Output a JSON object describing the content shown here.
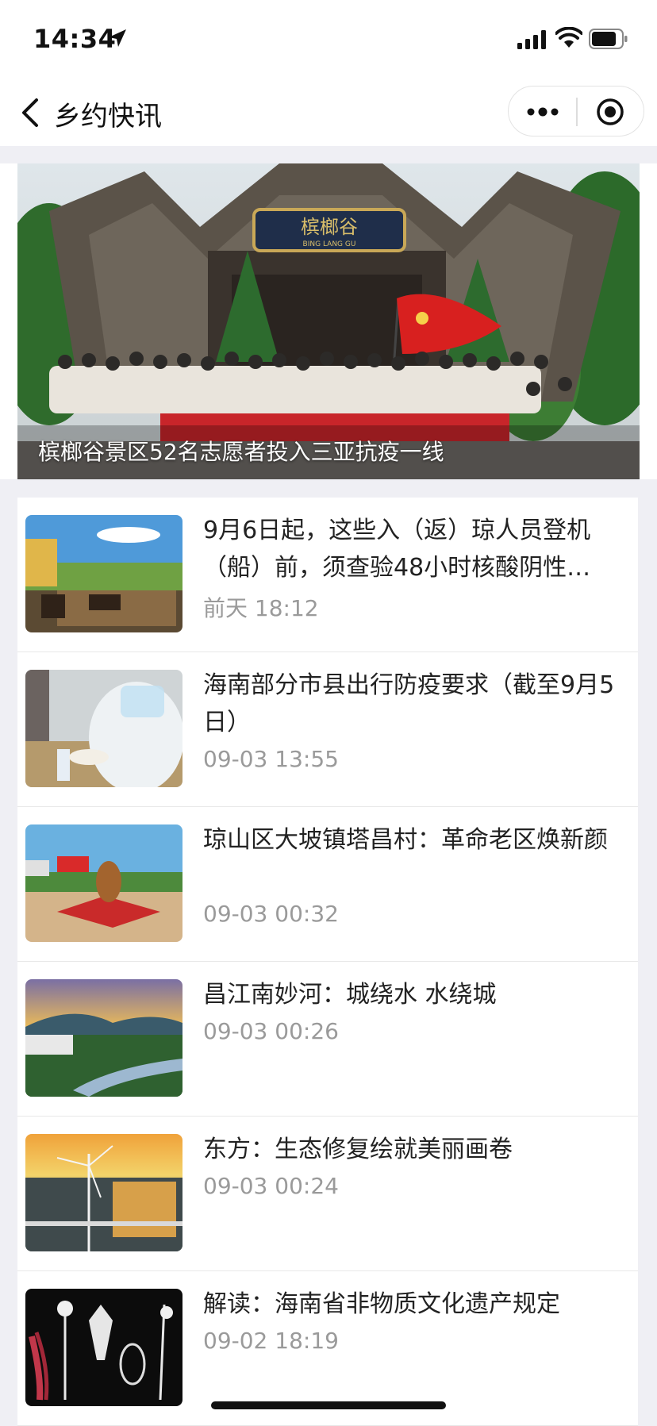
{
  "status_bar": {
    "time": "14:34"
  },
  "nav": {
    "title": "乡约快讯"
  },
  "banner": {
    "caption": "槟榔谷景区52名志愿者投入三亚抗疫一线",
    "sign_text": "槟榔谷",
    "sign_sub": "BING LANG GU"
  },
  "news": [
    {
      "title": "9月6日起，这些入（返）琼人员登机（船）前，须查验48小时核酸阴性…",
      "time": "前天 18:12"
    },
    {
      "title": "海南部分市县出行防疫要求（截至9月5日）",
      "time": "09-03 13:55"
    },
    {
      "title": "琼山区大坡镇塔昌村：革命老区焕新颜",
      "time": "09-03 00:32"
    },
    {
      "title": "昌江南妙河：城绕水 水绕城",
      "time": "09-03 00:26"
    },
    {
      "title": "东方：生态修复绘就美丽画卷",
      "time": "09-03 00:24"
    },
    {
      "title": "解读：海南省非物质文化遗产规定",
      "time": "09-02 18:19"
    }
  ]
}
